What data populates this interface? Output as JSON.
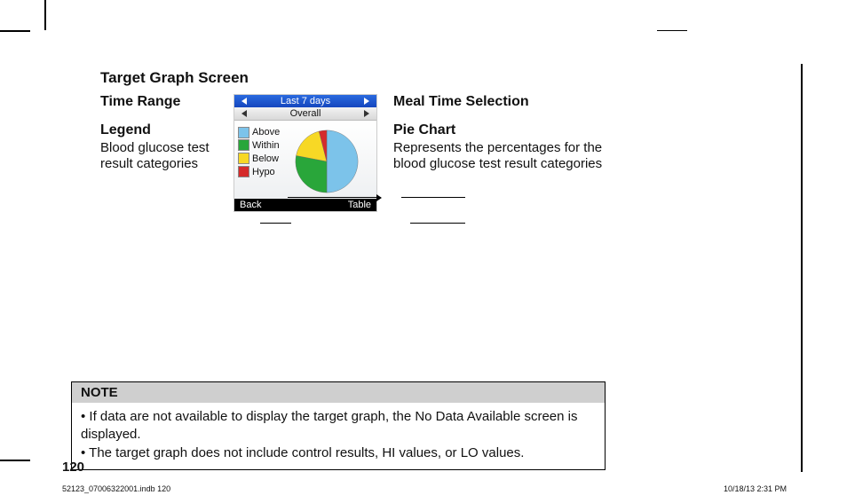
{
  "title": "Target Graph Screen",
  "callouts": {
    "time_range": {
      "heading": "Time Range"
    },
    "legend": {
      "heading": "Legend",
      "body": "Blood glucose test result categories"
    },
    "meal": {
      "heading": "Meal Time Selection"
    },
    "pie": {
      "heading": "Pie Chart",
      "body": "Represents the percentages for the blood glucose test result categories"
    }
  },
  "device": {
    "top_label": "Last 7 days",
    "sub_label": "Overall",
    "legend_items": {
      "above": "Above",
      "within": "Within",
      "below": "Below",
      "hypo": "Hypo"
    },
    "bottom_left": "Back",
    "bottom_right": "Table",
    "colors": {
      "above": "#7cc3ea",
      "within": "#29a63a",
      "below": "#f7d825",
      "hypo": "#d52b2b"
    }
  },
  "chart_data": {
    "type": "pie",
    "title": "Blood glucose test result categories",
    "categories": [
      "Above",
      "Within",
      "Below",
      "Hypo"
    ],
    "values": [
      50,
      28,
      18,
      4
    ],
    "colors": [
      "#7cc3ea",
      "#29a63a",
      "#f7d825",
      "#d52b2b"
    ]
  },
  "note": {
    "heading": "NOTE",
    "bullets": [
      "If data are not available to display the target graph, the No Data Available screen is displayed.",
      "The target graph does not include control results, HI values, or LO values."
    ]
  },
  "page_number": "120",
  "footer_left": "52123_07006322001.indb   120",
  "footer_right": "10/18/13   2:31 PM"
}
